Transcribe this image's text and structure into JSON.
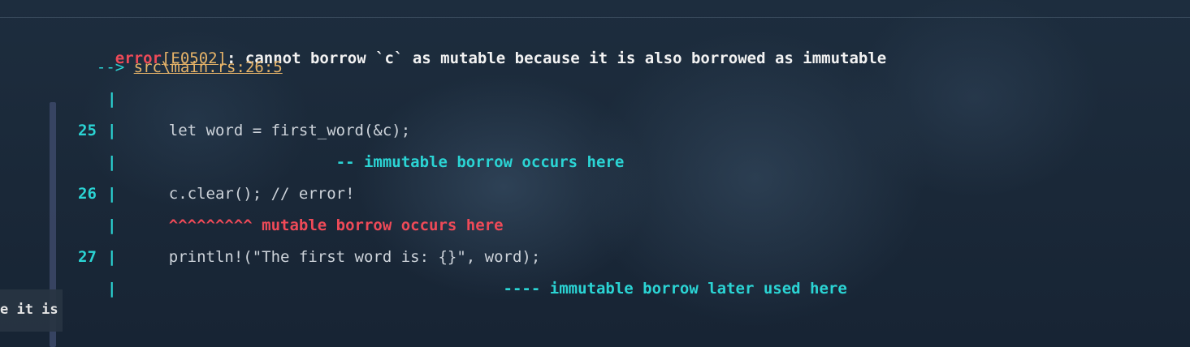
{
  "error": {
    "prefix": "error",
    "code": "[E0502]",
    "message": ": cannot borrow `c` as mutable because it is also borrowed as immutable"
  },
  "location": {
    "arrow": "-->",
    "path": "src\\main.rs:26:5"
  },
  "gutter_pipe": "|",
  "lines": [
    {
      "number": "25",
      "code": "    let word = first_word(&c);"
    },
    {
      "number": "26",
      "code": "    c.clear(); // error!"
    },
    {
      "number": "27",
      "code": "    println!(\"The first word is: {}\", word);"
    }
  ],
  "annotations": {
    "immutable_borrow": "                      -- immutable borrow occurs here",
    "mutable_borrow": "    ^^^^^^^^^ mutable borrow occurs here",
    "later_used": "                                        ---- immutable borrow later used here"
  },
  "side_panel": {
    "text": "e it is"
  },
  "colors": {
    "error_red": "#ef4a58",
    "link_yellow": "#e7b469",
    "accent_cyan": "#2bd4d4",
    "code_text": "#cdd3da",
    "background": "#1b2a3a"
  }
}
